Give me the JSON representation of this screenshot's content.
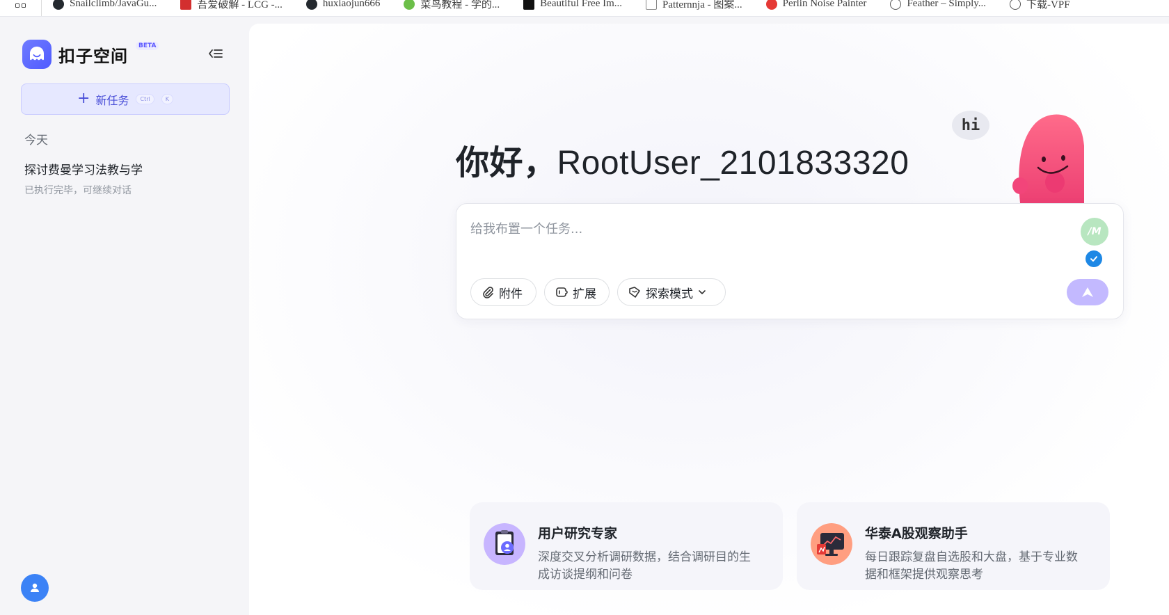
{
  "bookmarks": [
    {
      "label": "Snailclimb/JavaGu...",
      "icon": "github-icon",
      "color": "#24292f"
    },
    {
      "label": "吾爱破解 - LCG -...",
      "icon": "site-icon",
      "color": "#d32f2f"
    },
    {
      "label": "huxiaojun666",
      "icon": "github-icon",
      "color": "#24292f"
    },
    {
      "label": "菜鸟教程 - 学的...",
      "icon": "site-icon",
      "color": "#6cbf49"
    },
    {
      "label": "Beautiful Free Im...",
      "icon": "site-icon",
      "color": "#111111"
    },
    {
      "label": "Patternnja - 图案...",
      "icon": "site-icon",
      "color": "#888888"
    },
    {
      "label": "Perlin Noise Painter",
      "icon": "site-icon",
      "color": "#e53935"
    },
    {
      "label": "Feather – Simply...",
      "icon": "feather-icon",
      "color": "#555555"
    },
    {
      "label": "下载-VPF",
      "icon": "globe-icon",
      "color": "#555555"
    }
  ],
  "sidebar": {
    "app_name": "扣子空间",
    "beta": "BETA",
    "new_task": {
      "label": "新任务",
      "key1": "Ctrl",
      "key2": "K"
    },
    "section": "今天",
    "history": [
      {
        "title": "探讨费曼学习法教与学",
        "status": "已执行完毕，可继续对话"
      }
    ]
  },
  "main": {
    "greeting_prefix": "你好，",
    "username": "RootUser_2101833320",
    "mascot_bubble": "hi",
    "composer": {
      "placeholder": "给我布置一个任务...",
      "model_badge": "/M",
      "attach": "附件",
      "extend": "扩展",
      "mode": "探索模式"
    },
    "cards": [
      {
        "title": "用户研究专家",
        "desc": "深度交叉分析调研数据，结合调研目的生成访谈提纲和问卷",
        "icon": "user-research-icon"
      },
      {
        "title": "华泰A股观察助手",
        "desc": "每日跟踪复盘自选股和大盘，基于专业数据和框架提供观察思考",
        "icon": "stock-monitor-icon"
      }
    ]
  },
  "colors": {
    "accent": "#4f5bff",
    "new_task_bg": "#e6e8ff",
    "send_button": "#c3b9ff",
    "mascot": "#f0437a"
  }
}
